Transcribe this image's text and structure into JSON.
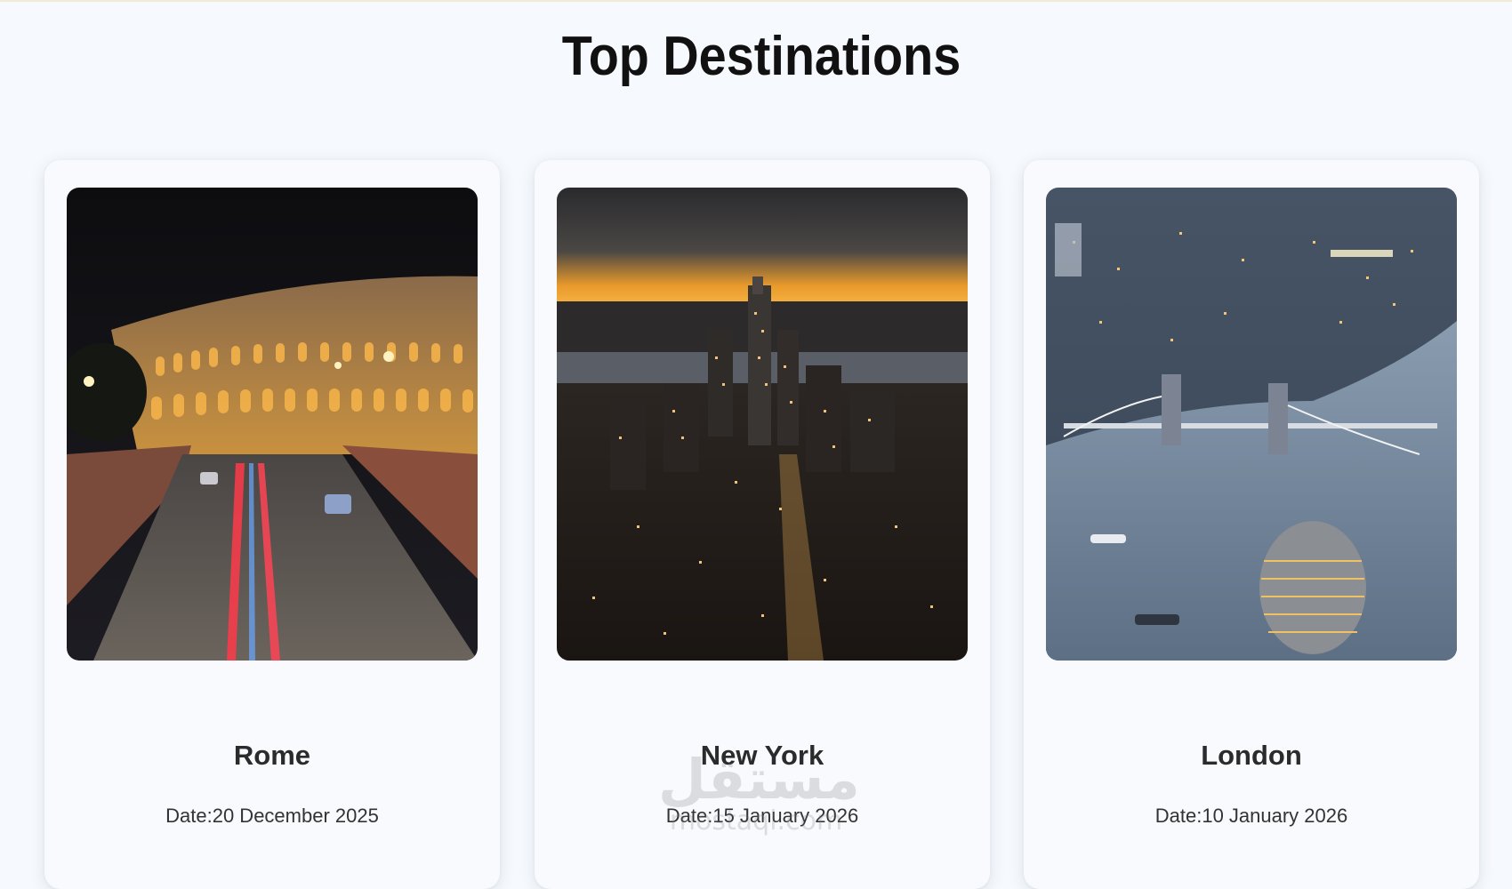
{
  "page": {
    "title": "Top Destinations"
  },
  "destinations": [
    {
      "name": "Rome",
      "date": "Date:20 December 2025",
      "image": "colosseum-night-photo"
    },
    {
      "name": "New York",
      "date": "Date:15 January 2026",
      "image": "manhattan-skyline-dusk-photo"
    },
    {
      "name": "London",
      "date": "Date:10 January 2026",
      "image": "tower-bridge-aerial-photo"
    }
  ],
  "watermark": {
    "arabic": "مستقل",
    "latin": "mostaql.com"
  },
  "colors": {
    "background": "#f6f9fd",
    "card": "#f8fafe",
    "title": "#111111"
  }
}
